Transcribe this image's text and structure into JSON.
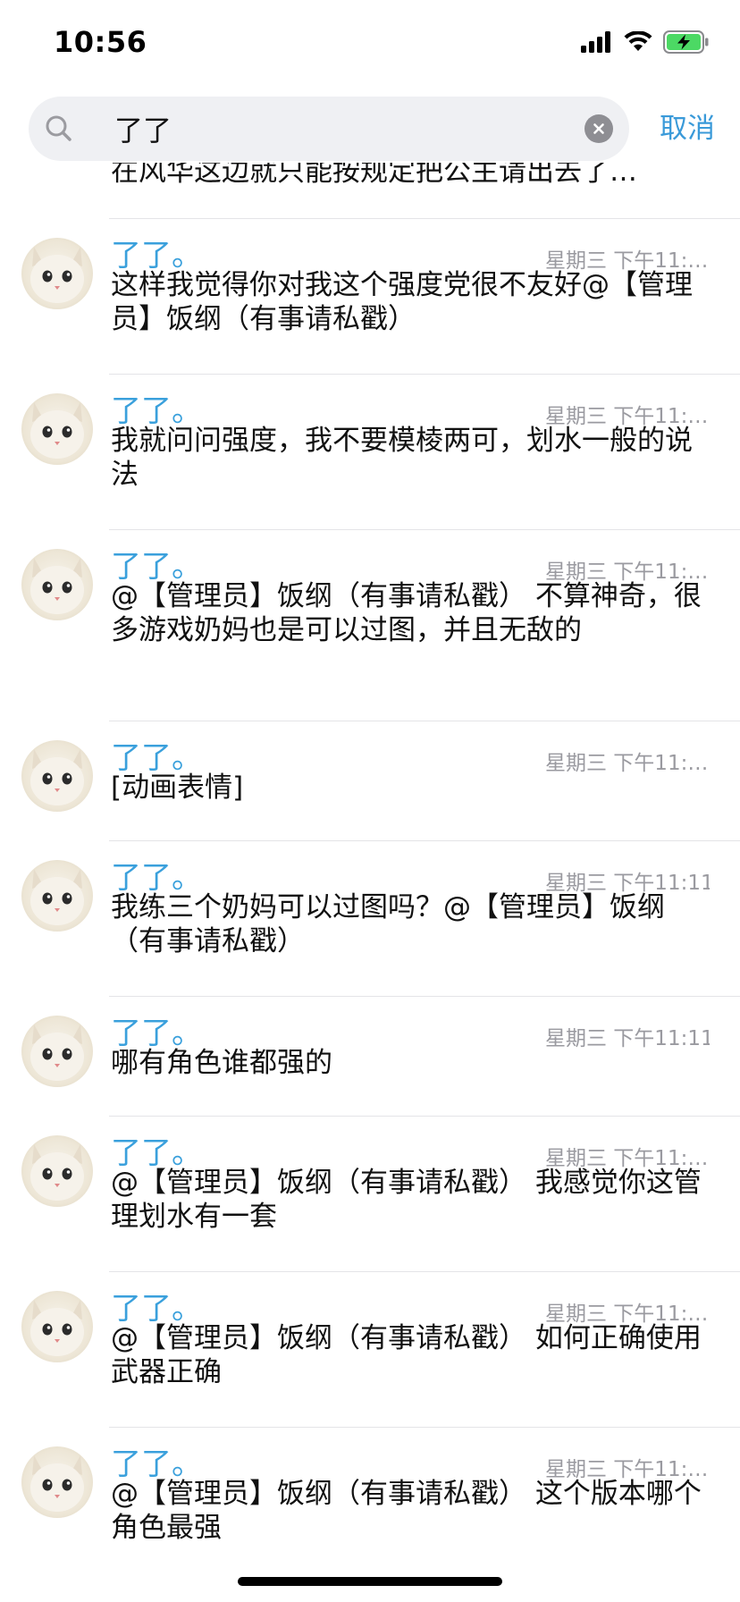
{
  "status_bar": {
    "time": "10:56"
  },
  "search": {
    "value": "了了",
    "cancel_label": "取消"
  },
  "results": {
    "partial_top_text": "在风华这边就只能按规定把公主请出去了…",
    "items": [
      {
        "sender": "了了。",
        "time": "星期三 下午11:…",
        "message": "这样我觉得你对我这个强度党很不友好@【管理员】饭纲（有事请私戳）"
      },
      {
        "sender": "了了。",
        "time": "星期三 下午11:…",
        "message": "我就问问强度，我不要模棱两可，划水一般的说法"
      },
      {
        "sender": "了了。",
        "time": "星期三 下午11:…",
        "message": "@【管理员】饭纲（有事请私戳） 不算神奇，很多游戏奶妈也是可以过图，并且无敌的"
      },
      {
        "sender": "了了。",
        "time": "星期三 下午11:…",
        "message": "[动画表情]"
      },
      {
        "sender": "了了。",
        "time": "星期三 下午11:11",
        "message": "我练三个奶妈可以过图吗？@【管理员】饭纲（有事请私戳）"
      },
      {
        "sender": "了了。",
        "time": "星期三 下午11:11",
        "message": "哪有角色谁都强的"
      },
      {
        "sender": "了了。",
        "time": "星期三 下午11:…",
        "message": "@【管理员】饭纲（有事请私戳） 我感觉你这管理划水有一套"
      },
      {
        "sender": "了了。",
        "time": "星期三 下午11:…",
        "message": "@【管理员】饭纲（有事请私戳） 如何正确使用武器正确"
      },
      {
        "sender": "了了。",
        "time": "星期三 下午11:…",
        "message": "@【管理员】饭纲（有事请私戳） 这个版本哪个角色最强"
      }
    ]
  },
  "colors": {
    "accent": "#3a9ad9",
    "sender": "#3aa0dc",
    "timestamp": "#9a9aa0",
    "battery": "#4cd964"
  },
  "icons": {
    "signal": "cellular-signal-icon",
    "wifi": "wifi-icon",
    "battery": "battery-charging-icon",
    "search": "search-icon",
    "clear": "clear-icon"
  }
}
